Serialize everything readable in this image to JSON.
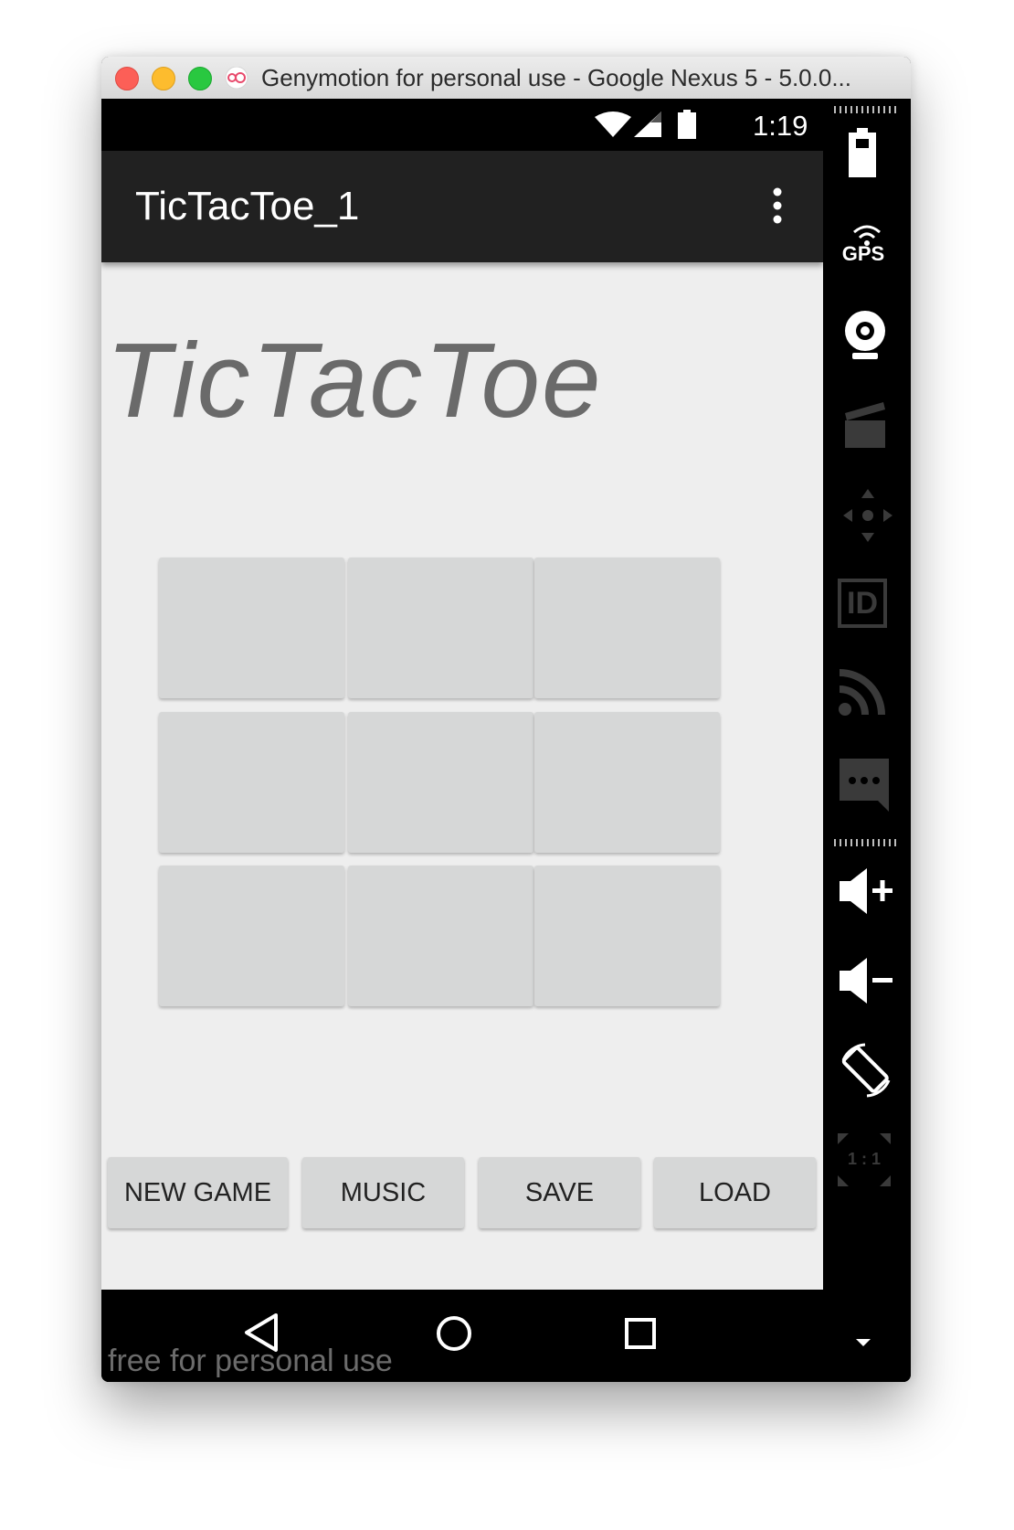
{
  "window": {
    "title": "Genymotion for personal use - Google Nexus 5 - 5.0.0..."
  },
  "status_bar": {
    "time": "1:19"
  },
  "app_bar": {
    "title": "TicTacToe_1"
  },
  "game": {
    "heading": "TicTacToe",
    "board": [
      "",
      "",
      "",
      "",
      "",
      "",
      "",
      "",
      ""
    ]
  },
  "buttons": {
    "new_game": "NEW GAME",
    "music": "MUSIC",
    "save": "SAVE",
    "load": "LOAD"
  },
  "watermark": "free for personal use",
  "sidebar": {
    "gps_label": "GPS",
    "id_label": "ID",
    "ratio_label": "1 : 1"
  },
  "colors": {
    "app_bar": "#212121",
    "background": "#eeeeee",
    "cell": "#d6d7d7",
    "heading": "#6a6a6a"
  }
}
